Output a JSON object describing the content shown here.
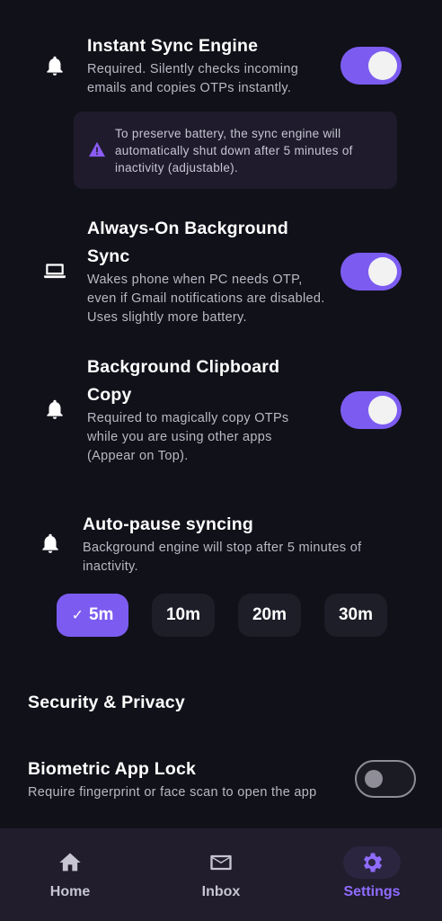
{
  "settings": {
    "instant_sync": {
      "title": "Instant Sync Engine",
      "description": "Required. Silently checks incoming emails and copies OTPs instantly.",
      "enabled": true,
      "icon": "bell-icon"
    },
    "battery_notice": {
      "text": "To preserve battery, the sync engine will automatically shut down after 5 minutes of inactivity (adjustable).",
      "icon": "warning-icon",
      "icon_color": "#8b5cf6"
    },
    "always_on": {
      "title": "Always-On Background Sync",
      "description": "Wakes phone when PC needs OTP, even if Gmail notifications are disabled. Uses slightly more battery.",
      "enabled": true,
      "icon": "laptop-icon"
    },
    "clipboard": {
      "title": "Background Clipboard Copy",
      "description": "Required to magically copy OTPs while you are using other apps (Appear on Top).",
      "enabled": true,
      "icon": "bell-icon"
    },
    "auto_pause": {
      "title": "Auto-pause syncing",
      "description": "Background engine will stop after 5 minutes of inactivity.",
      "icon": "bell-icon",
      "options": [
        "5m",
        "10m",
        "20m",
        "30m"
      ],
      "selected": "5m"
    },
    "security_section": {
      "title": "Security & Privacy"
    },
    "biometric": {
      "title": "Biometric App Lock",
      "description": "Require fingerprint or face scan to open the app",
      "enabled": false
    }
  },
  "nav": {
    "items": [
      {
        "label": "Home",
        "icon": "home-icon"
      },
      {
        "label": "Inbox",
        "icon": "mail-icon"
      },
      {
        "label": "Settings",
        "icon": "gear-icon",
        "active": true
      }
    ]
  },
  "colors": {
    "background": "#11111a",
    "accent": "#7c5cf0",
    "nav_background": "#211d2d"
  }
}
